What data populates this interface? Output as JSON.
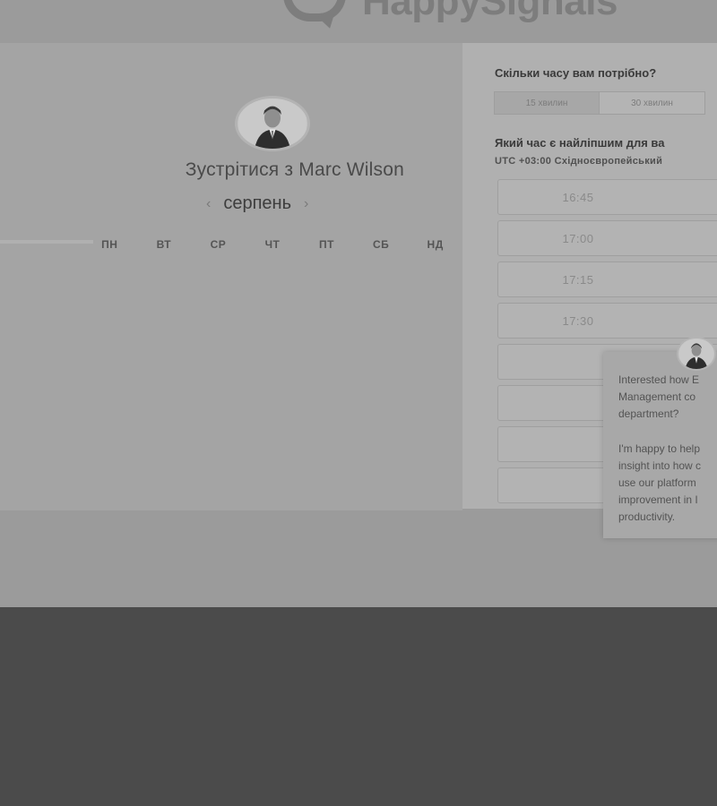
{
  "brand": {
    "name": "HappySignals",
    "logo_icon": "speech-bubble-heart-icon"
  },
  "calendar": {
    "title": "Зустрітися з Marc Wilson",
    "month": "серпень",
    "prev_icon": "chevron-left-icon",
    "next_icon": "chevron-right-icon",
    "weekdays": [
      "ПН",
      "ВТ",
      "СР",
      "ЧТ",
      "ПТ",
      "СБ",
      "НД"
    ]
  },
  "scheduler": {
    "duration_question": "Скільки часу вам потрібно?",
    "durations": [
      {
        "label": "15 хвилин"
      },
      {
        "label": "30 хвилин"
      }
    ],
    "time_question": "Який час є найліпшим для ва",
    "timezone": "UTC +03:00 Східноєвропейський",
    "slots": [
      "16:45",
      "17:00",
      "17:15",
      "17:30",
      "",
      "",
      "",
      ""
    ]
  },
  "chat": {
    "line1": "Interested how E",
    "line2": "Management co",
    "line3": "department?",
    "line4": "I'm happy to help",
    "line5": "insight into how c",
    "line6": "use our platform",
    "line7": "improvement in I",
    "line8": "productivity."
  },
  "colors": {
    "page_bg": "#9b9b9b",
    "panel_left": "#a4a4a4",
    "panel_right": "#b0b0b0",
    "footer_bg": "#4b4b4b"
  }
}
